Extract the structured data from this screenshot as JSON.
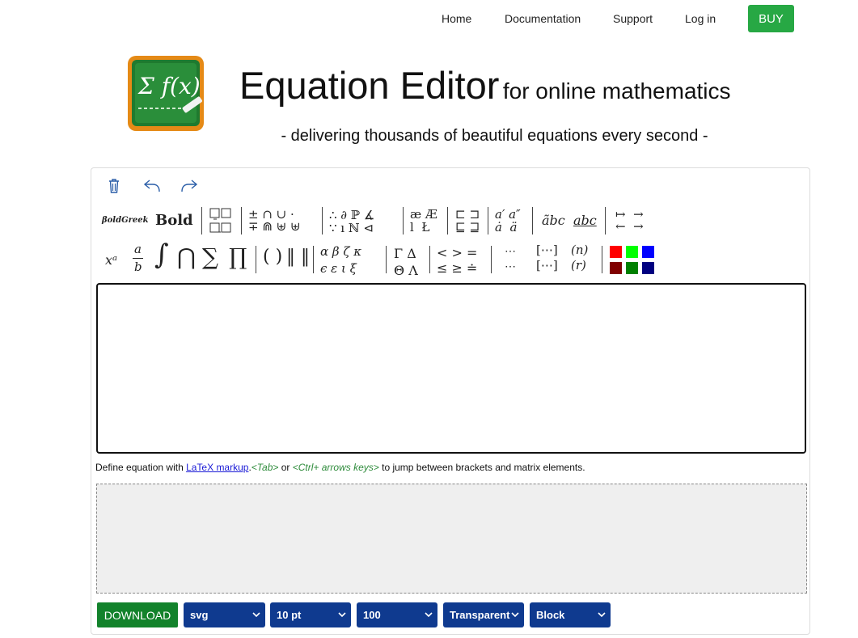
{
  "nav": {
    "home": "Home",
    "documentation": "Documentation",
    "support": "Support",
    "login": "Log in",
    "buy": "BUY"
  },
  "header": {
    "logo_text": "Σ f(x)",
    "title_main": "Equation Editor",
    "title_sub": "for online mathematics",
    "tagline": "- delivering thousands of beautiful equations every second -"
  },
  "toolbar": {
    "row1": {
      "bold_greek": "βoldGreek",
      "bold": "Bold"
    },
    "row2": {
      "superscript": "xᵃ",
      "fraction_num": "a",
      "fraction_den": "b",
      "integral": "∫",
      "intersection": "⋂",
      "sum": "∑",
      "product": "∏",
      "parens": "( )",
      "norm": "‖ ‖"
    }
  },
  "editor": {
    "value": "",
    "placeholder": ""
  },
  "hint": {
    "prefix": "Define equation with ",
    "link": "LaTeX markup",
    "dot": ".",
    "tab": "<Tab>",
    "or": " or ",
    "arrows": "<Ctrl+ arrows keys>",
    "suffix": " to jump between brackets and matrix elements."
  },
  "controls": {
    "download": "DOWNLOAD",
    "format": "svg",
    "size": "10 pt",
    "resolution": "100",
    "background": "Transparent",
    "display": "Block"
  },
  "colors": {
    "buy": "#27a844",
    "download": "#12822b",
    "select": "#0f3a8f",
    "swatches": [
      "#ff0000",
      "#00ff00",
      "#0000ff",
      "#800000",
      "#008000",
      "#000080"
    ]
  }
}
